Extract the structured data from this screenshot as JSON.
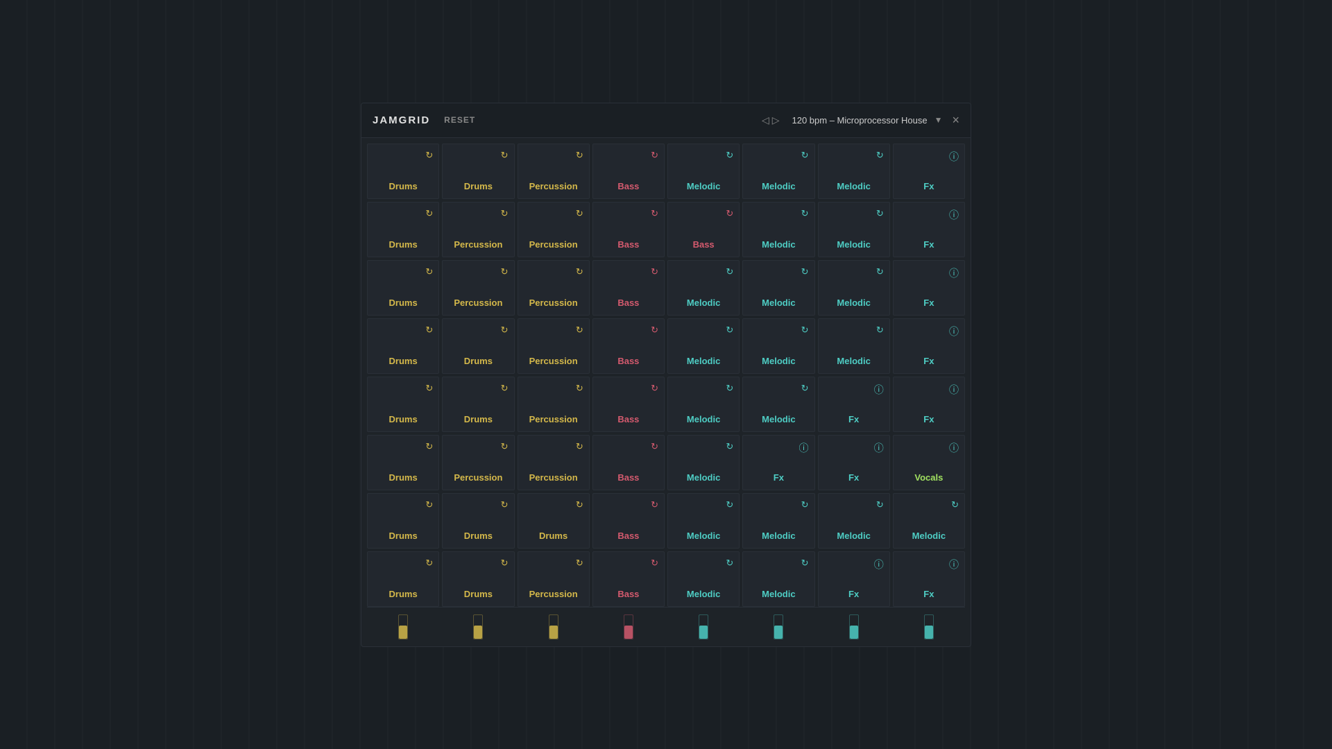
{
  "app": {
    "title": "JAMGRID",
    "reset_label": "RESET",
    "preset": "120 bpm – Microprocessor House",
    "close_label": "×"
  },
  "grid": {
    "rows": [
      [
        {
          "type": "Drums",
          "icon": "refresh",
          "color": "drums"
        },
        {
          "type": "Drums",
          "icon": "refresh",
          "color": "drums"
        },
        {
          "type": "Percussion",
          "icon": "refresh",
          "color": "percussion"
        },
        {
          "type": "Bass",
          "icon": "refresh",
          "color": "bass"
        },
        {
          "type": "Melodic",
          "icon": "refresh",
          "color": "melodic"
        },
        {
          "type": "Melodic",
          "icon": "refresh",
          "color": "melodic"
        },
        {
          "type": "Melodic",
          "icon": "refresh",
          "color": "melodic"
        },
        {
          "type": "Fx",
          "icon": "info",
          "color": "fx"
        }
      ],
      [
        {
          "type": "Drums",
          "icon": "refresh",
          "color": "drums"
        },
        {
          "type": "Percussion",
          "icon": "refresh",
          "color": "percussion"
        },
        {
          "type": "Percussion",
          "icon": "refresh",
          "color": "percussion"
        },
        {
          "type": "Bass",
          "icon": "refresh",
          "color": "bass"
        },
        {
          "type": "Bass",
          "icon": "refresh",
          "color": "bass"
        },
        {
          "type": "Melodic",
          "icon": "refresh",
          "color": "melodic"
        },
        {
          "type": "Melodic",
          "icon": "refresh",
          "color": "melodic"
        },
        {
          "type": "Fx",
          "icon": "info",
          "color": "fx"
        }
      ],
      [
        {
          "type": "Drums",
          "icon": "refresh",
          "color": "drums"
        },
        {
          "type": "Percussion",
          "icon": "refresh",
          "color": "percussion"
        },
        {
          "type": "Percussion",
          "icon": "refresh",
          "color": "percussion"
        },
        {
          "type": "Bass",
          "icon": "refresh",
          "color": "bass"
        },
        {
          "type": "Melodic",
          "icon": "refresh",
          "color": "melodic"
        },
        {
          "type": "Melodic",
          "icon": "refresh",
          "color": "melodic"
        },
        {
          "type": "Melodic",
          "icon": "refresh",
          "color": "melodic"
        },
        {
          "type": "Fx",
          "icon": "info",
          "color": "fx"
        }
      ],
      [
        {
          "type": "Drums",
          "icon": "refresh",
          "color": "drums"
        },
        {
          "type": "Drums",
          "icon": "refresh",
          "color": "drums"
        },
        {
          "type": "Percussion",
          "icon": "refresh",
          "color": "percussion"
        },
        {
          "type": "Bass",
          "icon": "refresh",
          "color": "bass"
        },
        {
          "type": "Melodic",
          "icon": "refresh",
          "color": "melodic"
        },
        {
          "type": "Melodic",
          "icon": "refresh",
          "color": "melodic"
        },
        {
          "type": "Melodic",
          "icon": "refresh",
          "color": "melodic"
        },
        {
          "type": "Fx",
          "icon": "info",
          "color": "fx"
        }
      ],
      [
        {
          "type": "Drums",
          "icon": "refresh",
          "color": "drums"
        },
        {
          "type": "Drums",
          "icon": "refresh",
          "color": "drums"
        },
        {
          "type": "Percussion",
          "icon": "refresh",
          "color": "percussion"
        },
        {
          "type": "Bass",
          "icon": "refresh",
          "color": "bass"
        },
        {
          "type": "Melodic",
          "icon": "refresh",
          "color": "melodic"
        },
        {
          "type": "Melodic",
          "icon": "refresh",
          "color": "melodic"
        },
        {
          "type": "Fx",
          "icon": "info",
          "color": "fx"
        },
        {
          "type": "Fx",
          "icon": "info",
          "color": "fx"
        }
      ],
      [
        {
          "type": "Drums",
          "icon": "refresh",
          "color": "drums"
        },
        {
          "type": "Percussion",
          "icon": "refresh",
          "color": "percussion"
        },
        {
          "type": "Percussion",
          "icon": "refresh",
          "color": "percussion"
        },
        {
          "type": "Bass",
          "icon": "refresh",
          "color": "bass"
        },
        {
          "type": "Melodic",
          "icon": "refresh",
          "color": "melodic"
        },
        {
          "type": "Fx",
          "icon": "info",
          "color": "fx"
        },
        {
          "type": "Fx",
          "icon": "info",
          "color": "fx"
        },
        {
          "type": "Vocals",
          "icon": "info",
          "color": "vocals"
        }
      ],
      [
        {
          "type": "Drums",
          "icon": "refresh",
          "color": "drums"
        },
        {
          "type": "Drums",
          "icon": "refresh",
          "color": "drums"
        },
        {
          "type": "Drums",
          "icon": "refresh",
          "color": "drums"
        },
        {
          "type": "Bass",
          "icon": "refresh",
          "color": "bass"
        },
        {
          "type": "Melodic",
          "icon": "refresh",
          "color": "melodic"
        },
        {
          "type": "Melodic",
          "icon": "refresh",
          "color": "melodic"
        },
        {
          "type": "Melodic",
          "icon": "refresh",
          "color": "melodic"
        },
        {
          "type": "Melodic",
          "icon": "refresh",
          "color": "melodic"
        }
      ],
      [
        {
          "type": "Drums",
          "icon": "refresh",
          "color": "drums"
        },
        {
          "type": "Drums",
          "icon": "refresh",
          "color": "drums"
        },
        {
          "type": "Percussion",
          "icon": "refresh",
          "color": "percussion"
        },
        {
          "type": "Bass",
          "icon": "refresh",
          "color": "bass"
        },
        {
          "type": "Melodic",
          "icon": "refresh",
          "color": "melodic"
        },
        {
          "type": "Melodic",
          "icon": "refresh",
          "color": "melodic"
        },
        {
          "type": "Fx",
          "icon": "info",
          "color": "fx"
        },
        {
          "type": "Fx",
          "icon": "info",
          "color": "fx"
        }
      ]
    ]
  },
  "bottom_bars": [
    {
      "color": "#d4b84a",
      "height": 55
    },
    {
      "color": "#d4b84a",
      "height": 55
    },
    {
      "color": "#d4b84a",
      "height": 55
    },
    {
      "color": "#d45a6e",
      "height": 55
    },
    {
      "color": "#4ecdc4",
      "height": 55
    },
    {
      "color": "#4ecdc4",
      "height": 55
    },
    {
      "color": "#4ecdc4",
      "height": 55
    },
    {
      "color": "#4ecdc4",
      "height": 55
    }
  ],
  "icons": {
    "refresh": "↻",
    "info": "ⓘ",
    "nav_left": "◁",
    "nav_right": "▷",
    "dropdown": "▼",
    "close": "×"
  }
}
